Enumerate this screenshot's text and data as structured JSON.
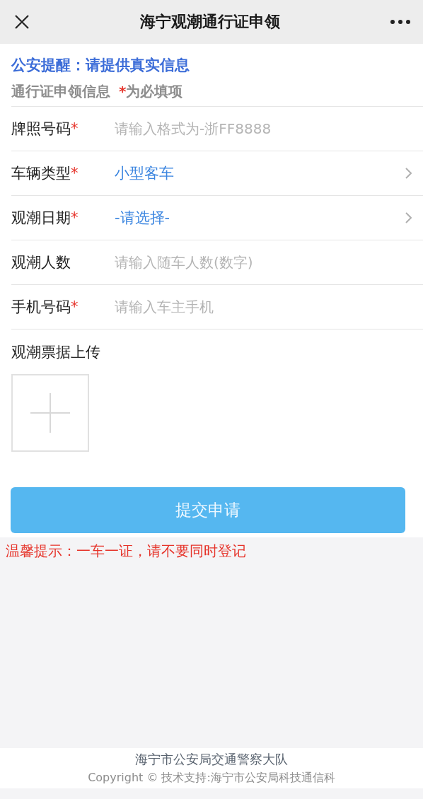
{
  "header": {
    "title": "海宁观潮通行证申领"
  },
  "notice": "公安提醒：请提供真实信息",
  "section": {
    "title": "通行证申领信息",
    "mark": "*",
    "note": "为必填项"
  },
  "fields": [
    {
      "kind": "input",
      "label": "牌照号码",
      "mark": "*",
      "placeholder": "请输入格式为-浙FF8888"
    },
    {
      "kind": "select",
      "label": "车辆类型",
      "mark": "*",
      "value": "小型客车"
    },
    {
      "kind": "select",
      "label": "观潮日期",
      "mark": "*",
      "value": "-请选择-"
    },
    {
      "kind": "input",
      "label": "观潮人数",
      "placeholder": "请输入随车人数(数字)"
    },
    {
      "kind": "input",
      "label": "手机号码",
      "mark": "*",
      "placeholder": "请输入车主手机"
    }
  ],
  "upload": {
    "label": "观潮票据上传"
  },
  "submit": "提交申请",
  "tip": "温馨提示：一车一证，请不要同时登记",
  "footer": {
    "org": "海宁市公安局交通警察大队",
    "copyright": "Copyright © 技术支持:海宁市公安局科技通信科"
  }
}
